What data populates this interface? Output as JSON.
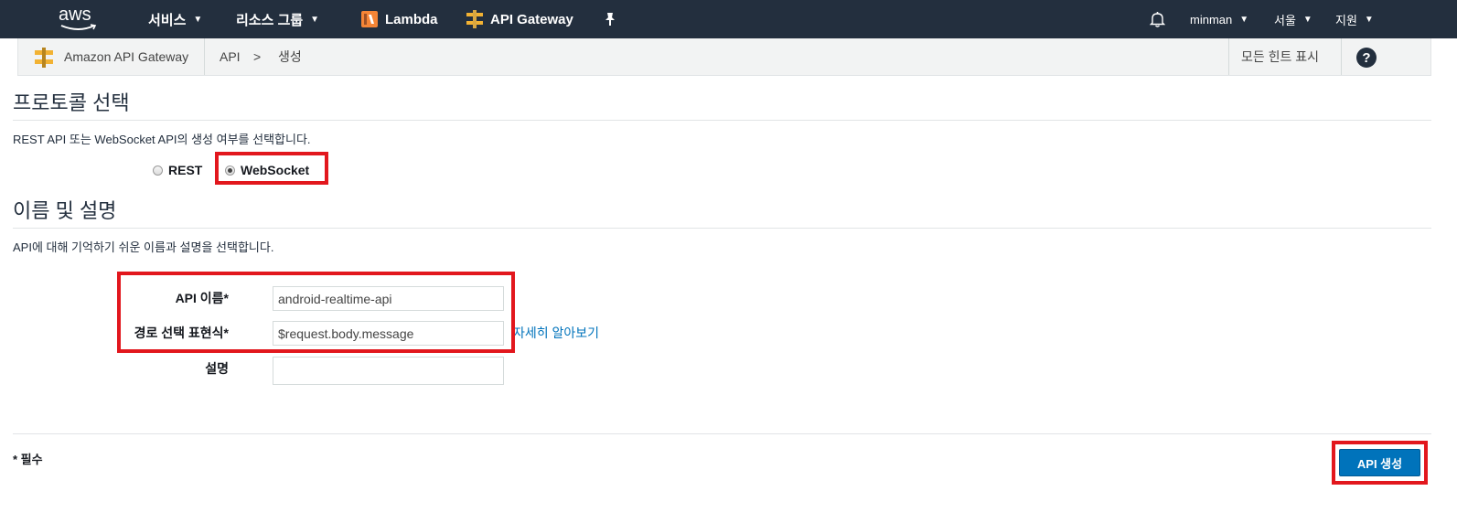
{
  "topnav": {
    "logo": "aws",
    "services": "서비스",
    "resource_groups": "리소스 그룹",
    "lambda": "Lambda",
    "api_gateway": "API Gateway",
    "user": "minman",
    "region": "서울",
    "support": "지원",
    "icons": [
      "lambda-icon",
      "api-gateway-icon",
      "pin-icon",
      "bell-icon"
    ]
  },
  "breadcrumb": {
    "service": "Amazon API Gateway",
    "level1": "API",
    "separator": ">",
    "level2": "생성",
    "hints": "모든 힌트 표시",
    "help_icon": "question-icon"
  },
  "protocol": {
    "title": "프로토콜 선택",
    "description": "REST API 또는 WebSocket API의 생성 여부를 선택합니다.",
    "options": [
      "REST",
      "WebSocket"
    ],
    "selected": "WebSocket"
  },
  "name_section": {
    "title": "이름 및 설명",
    "description": "API에 대해 기억하기 쉬운 이름과 설명을 선택합니다.",
    "api_name_label": "API 이름*",
    "api_name_value": "android-realtime-api",
    "route_label": "경로 선택 표현식*",
    "route_value": "$request.body.message",
    "learn_more": "자세히 알아보기",
    "desc_label": "설명",
    "desc_value": ""
  },
  "footer": {
    "required": "* 필수",
    "create_button": "API 생성"
  },
  "colors": {
    "nav_bg": "#232f3e",
    "highlight": "#e2171d",
    "primary_button": "#0073bb",
    "link": "#0073bb",
    "logo_accent": "#ff9900"
  }
}
